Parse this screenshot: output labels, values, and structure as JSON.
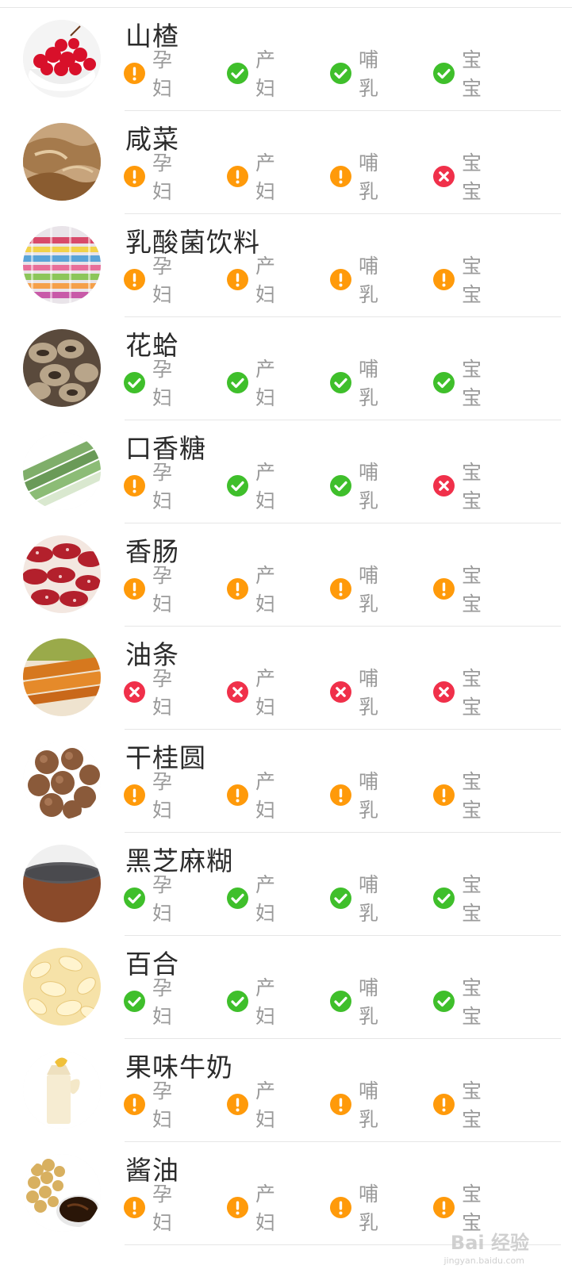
{
  "foods": [
    {
      "name": "山楂",
      "image": "hawthorn",
      "tags": [
        {
          "label": "孕妇",
          "status": "caution"
        },
        {
          "label": "产妇",
          "status": "ok"
        },
        {
          "label": "哺乳",
          "status": "ok"
        },
        {
          "label": "宝宝",
          "status": "ok"
        }
      ]
    },
    {
      "name": "咸菜",
      "image": "pickles",
      "tags": [
        {
          "label": "孕妇",
          "status": "caution"
        },
        {
          "label": "产妇",
          "status": "caution"
        },
        {
          "label": "哺乳",
          "status": "caution"
        },
        {
          "label": "宝宝",
          "status": "no"
        }
      ]
    },
    {
      "name": "乳酸菌饮料",
      "image": "yogurt-drink-shelf",
      "tags": [
        {
          "label": "孕妇",
          "status": "caution"
        },
        {
          "label": "产妇",
          "status": "caution"
        },
        {
          "label": "哺乳",
          "status": "caution"
        },
        {
          "label": "宝宝",
          "status": "caution"
        }
      ]
    },
    {
      "name": "花蛤",
      "image": "clams",
      "tags": [
        {
          "label": "孕妇",
          "status": "ok"
        },
        {
          "label": "产妇",
          "status": "ok"
        },
        {
          "label": "哺乳",
          "status": "ok"
        },
        {
          "label": "宝宝",
          "status": "ok"
        }
      ]
    },
    {
      "name": "口香糖",
      "image": "chewing-gum",
      "tags": [
        {
          "label": "孕妇",
          "status": "caution"
        },
        {
          "label": "产妇",
          "status": "ok"
        },
        {
          "label": "哺乳",
          "status": "ok"
        },
        {
          "label": "宝宝",
          "status": "no"
        }
      ]
    },
    {
      "name": "香肠",
      "image": "sausage",
      "tags": [
        {
          "label": "孕妇",
          "status": "caution"
        },
        {
          "label": "产妇",
          "status": "caution"
        },
        {
          "label": "哺乳",
          "status": "caution"
        },
        {
          "label": "宝宝",
          "status": "caution"
        }
      ]
    },
    {
      "name": "油条",
      "image": "fried-dough",
      "tags": [
        {
          "label": "孕妇",
          "status": "no"
        },
        {
          "label": "产妇",
          "status": "no"
        },
        {
          "label": "哺乳",
          "status": "no"
        },
        {
          "label": "宝宝",
          "status": "no"
        }
      ]
    },
    {
      "name": "干桂圆",
      "image": "dried-longan",
      "tags": [
        {
          "label": "孕妇",
          "status": "caution"
        },
        {
          "label": "产妇",
          "status": "caution"
        },
        {
          "label": "哺乳",
          "status": "caution"
        },
        {
          "label": "宝宝",
          "status": "caution"
        }
      ]
    },
    {
      "name": "黑芝麻糊",
      "image": "black-sesame-paste",
      "tags": [
        {
          "label": "孕妇",
          "status": "ok"
        },
        {
          "label": "产妇",
          "status": "ok"
        },
        {
          "label": "哺乳",
          "status": "ok"
        },
        {
          "label": "宝宝",
          "status": "ok"
        }
      ]
    },
    {
      "name": "百合",
      "image": "lily-bulb",
      "tags": [
        {
          "label": "孕妇",
          "status": "ok"
        },
        {
          "label": "产妇",
          "status": "ok"
        },
        {
          "label": "哺乳",
          "status": "ok"
        },
        {
          "label": "宝宝",
          "status": "ok"
        }
      ]
    },
    {
      "name": "果味牛奶",
      "image": "fruit-milk",
      "tags": [
        {
          "label": "孕妇",
          "status": "caution"
        },
        {
          "label": "产妇",
          "status": "caution"
        },
        {
          "label": "哺乳",
          "status": "caution"
        },
        {
          "label": "宝宝",
          "status": "caution"
        }
      ]
    },
    {
      "name": "酱油",
      "image": "soy-sauce",
      "tags": [
        {
          "label": "孕妇",
          "status": "caution"
        },
        {
          "label": "产妇",
          "status": "caution"
        },
        {
          "label": "哺乳",
          "status": "caution"
        },
        {
          "label": "宝宝",
          "status": "caution"
        }
      ]
    }
  ],
  "status_colors": {
    "ok": "#3fbf2b",
    "caution": "#ff9a0a",
    "no": "#f0304a"
  },
  "status_icons": {
    "ok": "check-circle-icon",
    "caution": "exclamation-circle-icon",
    "no": "cross-circle-icon"
  },
  "watermark": {
    "text": "Bai 经验",
    "sub": "jingyan.baidu.com"
  }
}
